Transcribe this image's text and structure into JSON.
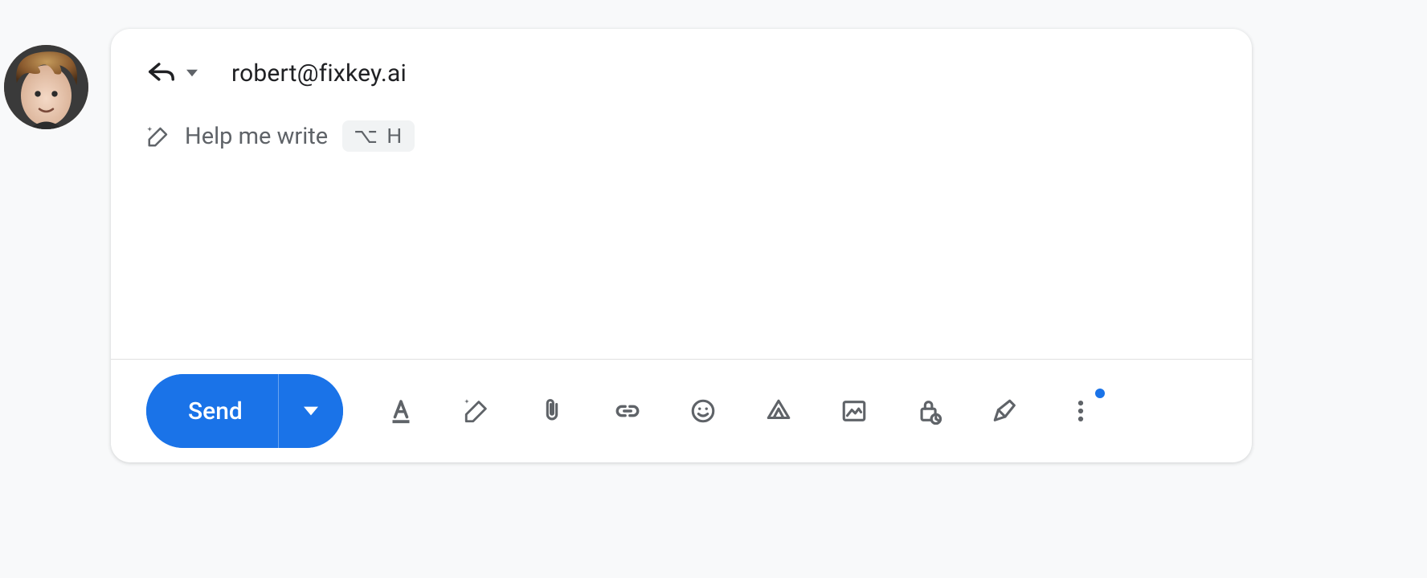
{
  "recipient": "robert@fixkey.ai",
  "help_me_write": {
    "label": "Help me write",
    "shortcut": "⌥ H"
  },
  "toolbar": {
    "send_label": "Send",
    "icons": {
      "format": "format-text-icon",
      "ai_pencil": "ai-write-icon",
      "attach": "attachment-icon",
      "link": "link-icon",
      "emoji": "emoji-icon",
      "drive": "drive-icon",
      "image": "image-icon",
      "confidential": "confidential-lock-icon",
      "signature": "signature-pen-icon",
      "more": "more-options-icon"
    },
    "more_has_indicator": true
  },
  "avatar_name": "user-avatar"
}
